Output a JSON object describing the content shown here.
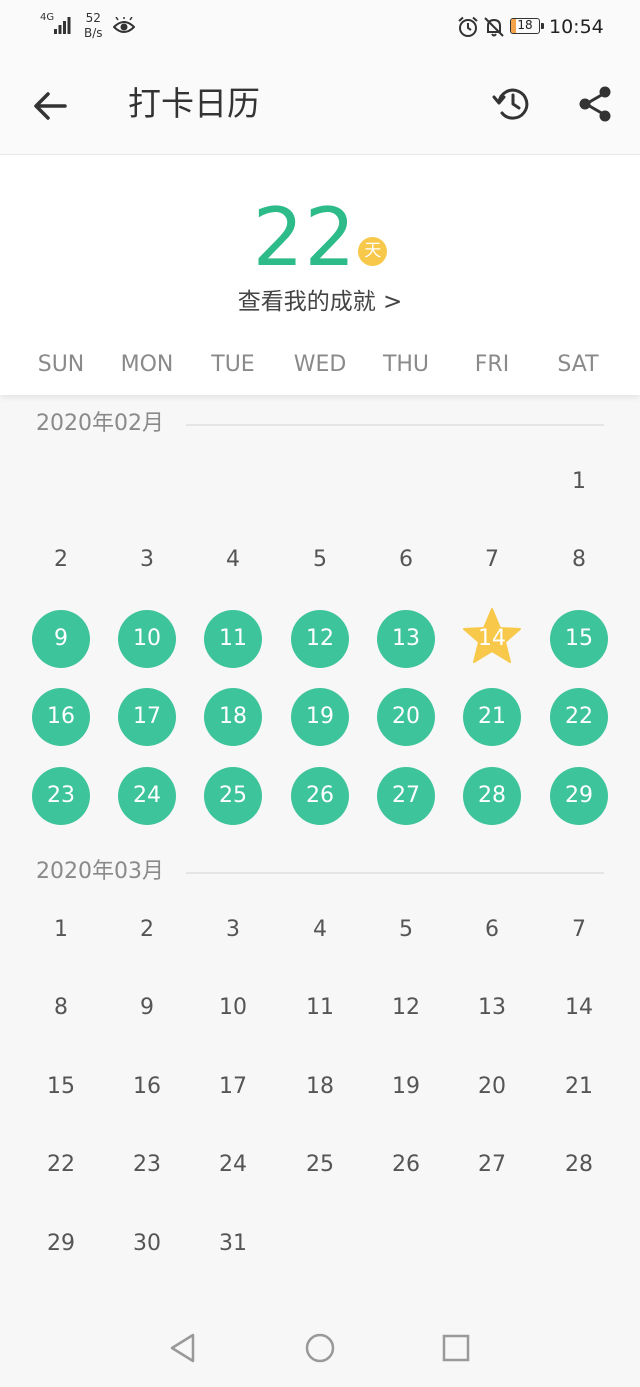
{
  "status_bar": {
    "network": "4G",
    "net_speed_value": "52",
    "net_speed_unit": "B/s",
    "battery_level": "18",
    "battery_color": "#f4a34a",
    "time": "10:54",
    "icons": [
      "signal-icon",
      "eye-icon",
      "alarm-icon",
      "mute-icon",
      "battery-icon"
    ]
  },
  "app_bar": {
    "title": "打卡日历",
    "icons": [
      "back-arrow-icon",
      "history-icon",
      "share-icon"
    ]
  },
  "streak": {
    "days": "22",
    "unit": "天",
    "link": "查看我的成就 >"
  },
  "weekdays": [
    "SUN",
    "MON",
    "TUE",
    "WED",
    "THU",
    "FRI",
    "SAT"
  ],
  "colors": {
    "accent": "#3ec49a",
    "streak_text": "#2dbb8a",
    "star": "#f7c84a"
  },
  "months": [
    {
      "label": "2020年02月",
      "first_weekday": 6,
      "day_count": 29,
      "checked_days": [
        9,
        10,
        11,
        12,
        13,
        15,
        16,
        17,
        18,
        19,
        20,
        21,
        22,
        23,
        24,
        25,
        26,
        27,
        28,
        29
      ],
      "star_days": [
        14
      ]
    },
    {
      "label": "2020年03月",
      "first_weekday": 0,
      "day_count": 31,
      "checked_days": [],
      "star_days": []
    }
  ],
  "nav_bar": {
    "icons": [
      "back-triangle-icon",
      "home-circle-icon",
      "recents-square-icon"
    ]
  }
}
